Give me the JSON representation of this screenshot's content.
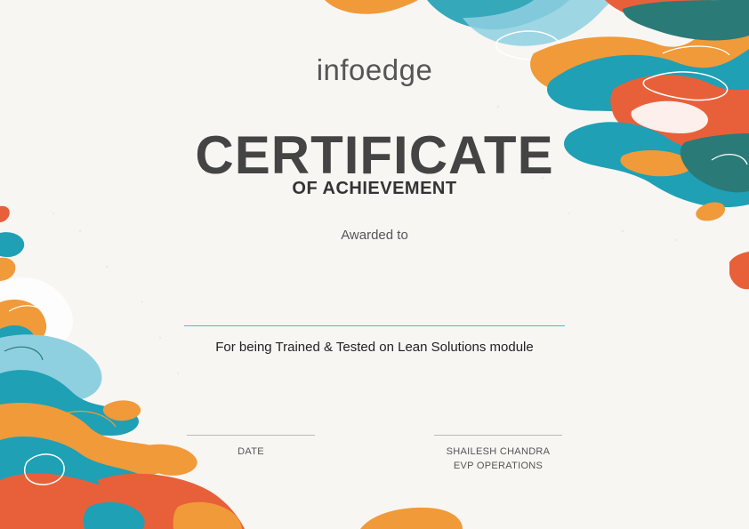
{
  "certificate": {
    "logo": "infoedge",
    "title": "CERTIFICATE",
    "subtitle": "OF ACHIEVEMENT",
    "awarded_label": "Awarded to",
    "recipient_name": "",
    "description": "For being Trained & Tested on Lean Solutions module",
    "date_label": "DATE",
    "signatory_name": "SHAILESH CHANDRA",
    "signatory_title": "EVP OPERATIONS"
  },
  "colors": {
    "background": "#f8f6f3",
    "teal": "#1fa0b4",
    "orange": "#f09a3a",
    "red_orange": "#e8603a",
    "light_blue": "#8fd0e0",
    "line_accent": "#55b4cf"
  }
}
